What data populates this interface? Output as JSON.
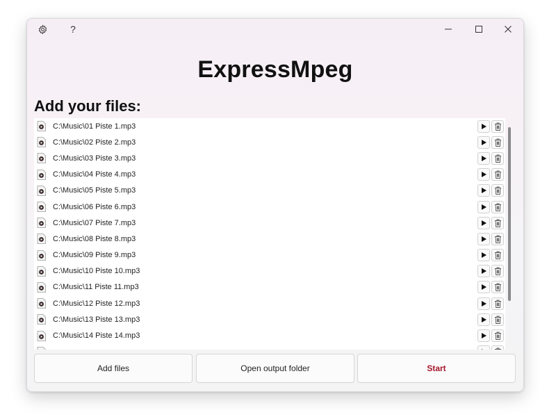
{
  "app": {
    "title": "ExpressMpeg",
    "help_label": "?"
  },
  "titlebar": {
    "icons": [
      "settings-gear-icon",
      "help-icon",
      "minimize-icon",
      "maximize-icon",
      "close-icon"
    ]
  },
  "files_section": {
    "heading": "Add your files:",
    "files": [
      {
        "path": "C:\\Music\\01 Piste 1.mp3"
      },
      {
        "path": "C:\\Music\\02 Piste 2.mp3"
      },
      {
        "path": "C:\\Music\\03 Piste 3.mp3"
      },
      {
        "path": "C:\\Music\\04 Piste 4.mp3"
      },
      {
        "path": "C:\\Music\\05 Piste 5.mp3"
      },
      {
        "path": "C:\\Music\\06 Piste 6.mp3"
      },
      {
        "path": "C:\\Music\\07 Piste 7.mp3"
      },
      {
        "path": "C:\\Music\\08 Piste 8.mp3"
      },
      {
        "path": "C:\\Music\\09 Piste 9.mp3"
      },
      {
        "path": "C:\\Music\\10 Piste 10.mp3"
      },
      {
        "path": "C:\\Music\\11 Piste 11.mp3"
      },
      {
        "path": "C:\\Music\\12 Piste 12.mp3"
      },
      {
        "path": "C:\\Music\\13 Piste 13.mp3"
      },
      {
        "path": "C:\\Music\\14 Piste 14.mp3"
      },
      {
        "path": ""
      }
    ]
  },
  "actions": {
    "add_files": "Add files",
    "open_output_folder": "Open output folder",
    "start": "Start"
  },
  "colors": {
    "start_accent": "#a3162a",
    "window_tint": "#f6eef5"
  }
}
